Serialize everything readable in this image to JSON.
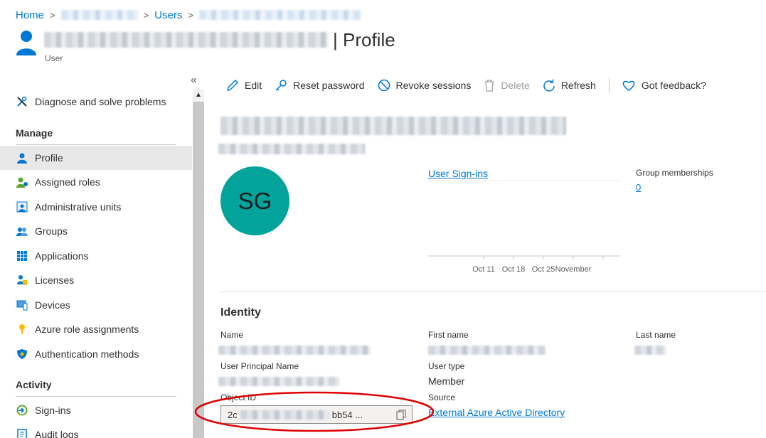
{
  "breadcrumb": {
    "home": "Home",
    "users": "Users",
    "separator": ">"
  },
  "header": {
    "title_suffix": "| Profile",
    "subtitle": "User"
  },
  "sidebar": {
    "collapse_glyph": "«",
    "diagnose": "Diagnose and solve problems",
    "manage_heading": "Manage",
    "items": [
      {
        "label": "Profile",
        "icon": "user-icon"
      },
      {
        "label": "Assigned roles",
        "icon": "roles-icon"
      },
      {
        "label": "Administrative units",
        "icon": "admin-units-icon"
      },
      {
        "label": "Groups",
        "icon": "groups-icon"
      },
      {
        "label": "Applications",
        "icon": "apps-grid-icon"
      },
      {
        "label": "Licenses",
        "icon": "license-icon"
      },
      {
        "label": "Devices",
        "icon": "device-icon"
      },
      {
        "label": "Azure role assignments",
        "icon": "key-icon"
      },
      {
        "label": "Authentication methods",
        "icon": "shield-icon"
      }
    ],
    "activity_heading": "Activity",
    "activity_items": [
      {
        "label": "Sign-ins",
        "icon": "sign-in-icon"
      },
      {
        "label": "Audit logs",
        "icon": "audit-log-icon"
      }
    ]
  },
  "toolbar": {
    "edit": "Edit",
    "reset_password": "Reset password",
    "revoke_sessions": "Revoke sessions",
    "delete": "Delete",
    "refresh": "Refresh",
    "feedback": "Got feedback?"
  },
  "profile": {
    "initials": "SG",
    "signins_link": "User Sign-ins",
    "group_memberships_label": "Group memberships",
    "group_memberships_count": "0",
    "chart_ticks": [
      "Oct 11",
      "Oct 18",
      "Oct 25",
      "November"
    ]
  },
  "identity": {
    "heading": "Identity",
    "name_label": "Name",
    "first_name_label": "First name",
    "last_name_label": "Last name",
    "upn_label": "User Principal Name",
    "user_type_label": "User type",
    "user_type_value": "Member",
    "object_id_label": "Object ID",
    "object_id_prefix": "2c",
    "object_id_suffix": "bb54 ...",
    "source_label": "Source",
    "source_value": "External Azure Active Directory"
  },
  "colors": {
    "accent": "#0078d4",
    "avatar": "#03a39b",
    "highlight": "#e00000"
  }
}
